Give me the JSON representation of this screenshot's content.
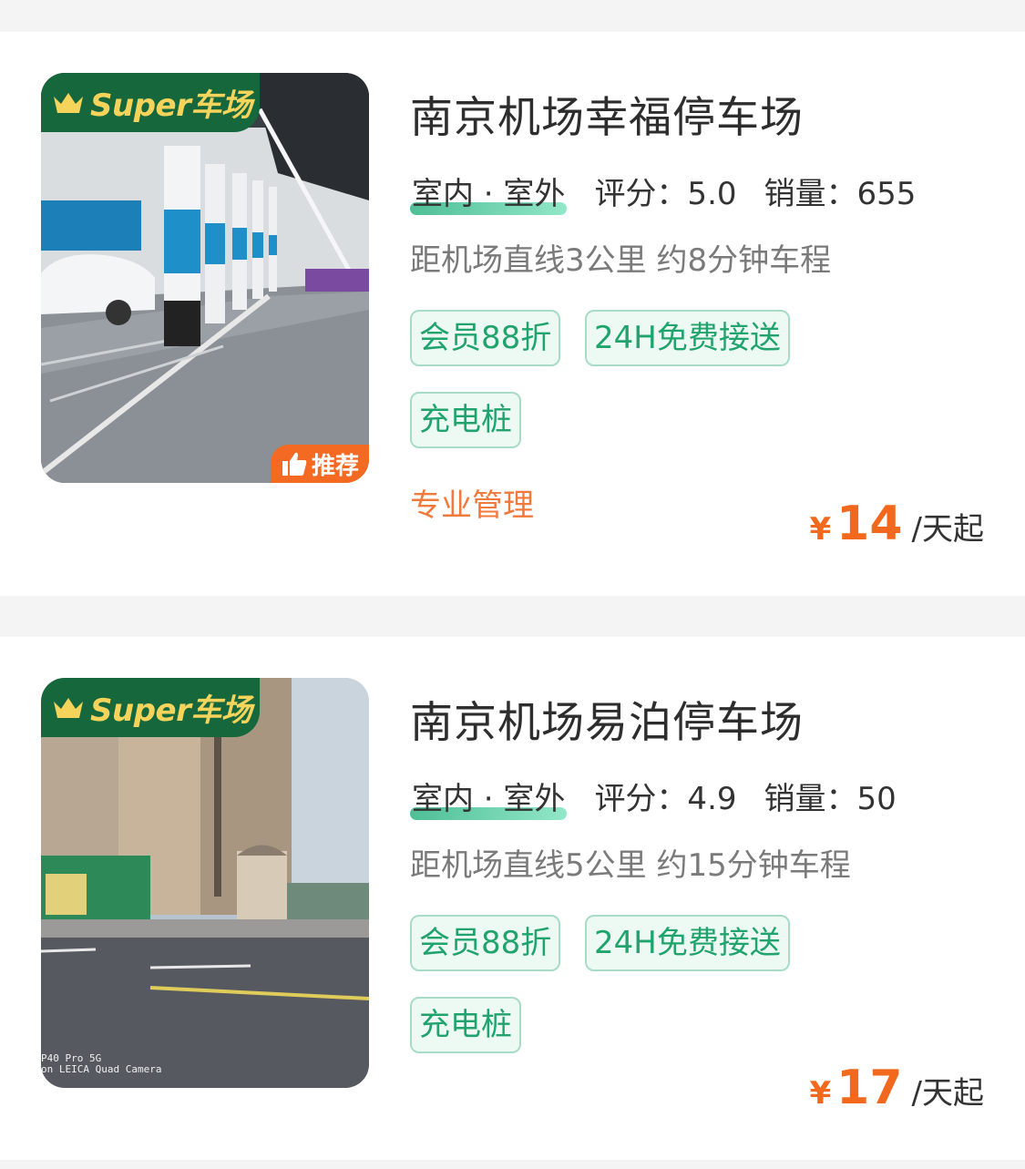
{
  "lots": [
    {
      "super_label": "Super车场",
      "recommend_label": "推荐",
      "name": "南京机场幸福停车场",
      "type": "室内 · 室外",
      "rating": "评分：5.0",
      "sales": "销量：655",
      "distance": "距机场直线3公里 约8分钟车程",
      "tags": [
        "会员88折",
        "24H免费接送",
        "充电桩"
      ],
      "feature": "专业管理",
      "price": {
        "currency": "¥",
        "amount": "14",
        "unit": "/天起"
      }
    },
    {
      "super_label": "Super车场",
      "name": "南京机场易泊停车场",
      "type": "室内 · 室外",
      "rating": "评分：4.9",
      "sales": "销量：50",
      "distance": "距机场直线5公里 约15分钟车程",
      "tags": [
        "会员88折",
        "24H免费接送",
        "充电桩"
      ],
      "photo_watermark": "P40 Pro 5G\non LEICA Quad Camera",
      "price": {
        "currency": "¥",
        "amount": "17",
        "unit": "/天起"
      }
    }
  ],
  "colors": {
    "brand_green": "#16683c",
    "crown_gold": "#f6d35b",
    "tag_green": "#21a36e",
    "price_orange": "#f2691e",
    "feature_orange": "#f07a3c"
  }
}
